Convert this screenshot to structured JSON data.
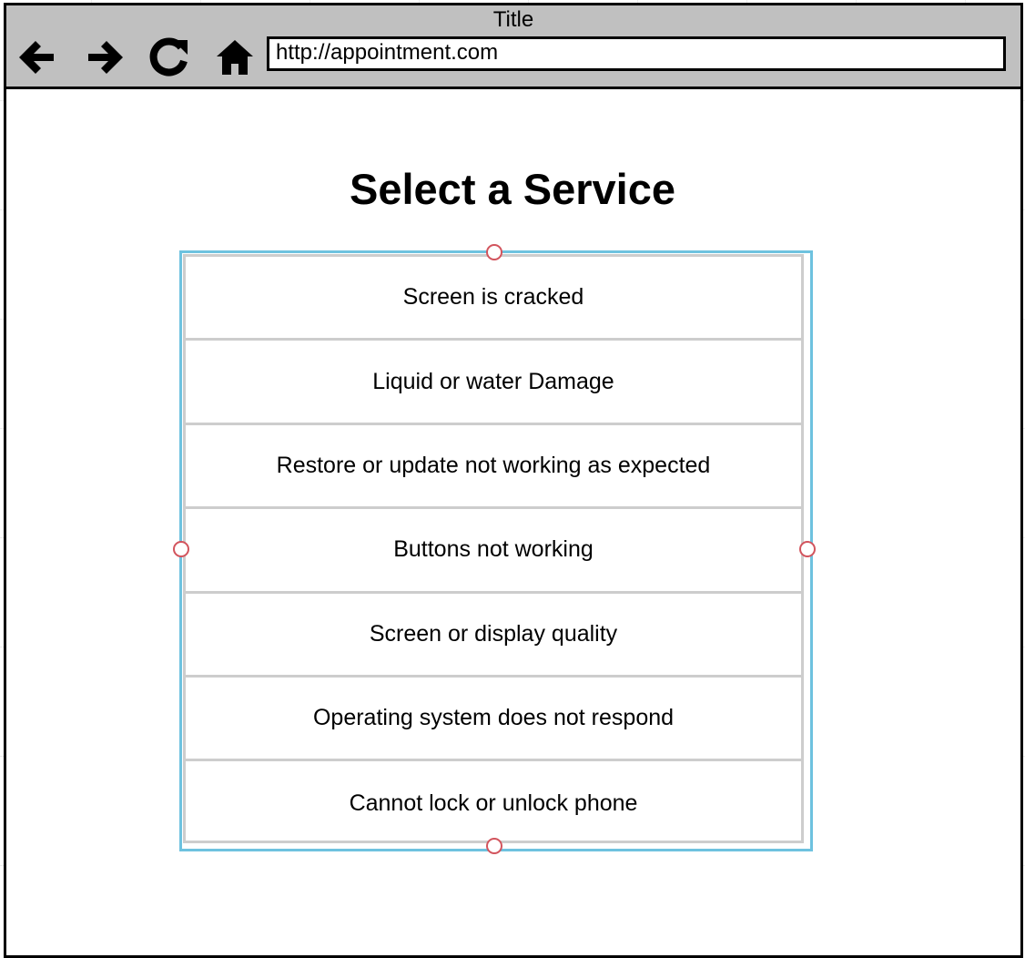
{
  "window": {
    "title": "Title",
    "url": "http://appointment.com"
  },
  "nav": {
    "back_icon": "arrow-left-icon",
    "forward_icon": "arrow-right-icon",
    "reload_icon": "reload-icon",
    "home_icon": "home-icon"
  },
  "page": {
    "heading": "Select a Service"
  },
  "services": [
    "Screen is cracked",
    "Liquid or water Damage",
    "Restore or update not working as expected",
    "Buttons not working",
    "Screen or display quality",
    "Operating system does not respond",
    "Cannot lock or unlock phone"
  ],
  "colors": {
    "chrome": "#c0c0c0",
    "selection_outline": "#6ec2df",
    "divider": "#cdcdcd",
    "handle": "#d2545d"
  }
}
